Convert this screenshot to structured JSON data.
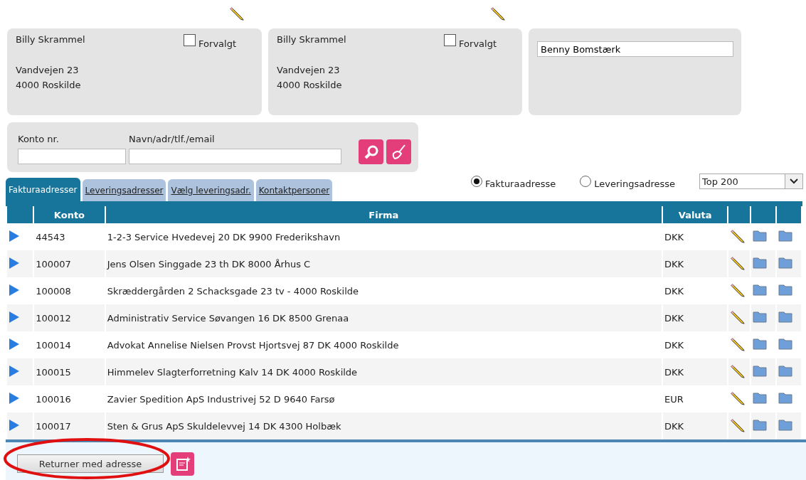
{
  "address_cards": [
    {
      "name": "Billy Skrammel",
      "default_label": "Forvalgt",
      "default_checked": false,
      "street": "Vandvejen 23",
      "city": "4000 Roskilde"
    },
    {
      "name": "Billy Skrammel",
      "default_label": "Forvalgt",
      "default_checked": false,
      "street": "Vandvejen 23",
      "city": "4000 Roskilde"
    }
  ],
  "contact_card": {
    "value": "Benny Bomstærk"
  },
  "search": {
    "fields": [
      {
        "label": "Konto nr."
      },
      {
        "label": "Navn/adr/tlf./email"
      }
    ]
  },
  "tabs": [
    {
      "label": "Fakturaadresser",
      "selected": true
    },
    {
      "label": "Leveringsadresser",
      "selected": false
    },
    {
      "label": "Vælg leveringsadr.",
      "selected": false
    },
    {
      "label": "Kontaktpersoner",
      "selected": false
    }
  ],
  "address_type": [
    {
      "label": "Fakturaadresse",
      "selected": true
    },
    {
      "label": "Leveringsadresse",
      "selected": false
    }
  ],
  "limit_select": {
    "value": "Top 200"
  },
  "table": {
    "columns": [
      "Konto",
      "Firma",
      "Valuta"
    ],
    "rows": [
      {
        "konto": "44543",
        "firma": "1-2-3 Service Hvedevej 20 DK 9900 Frederikshavn",
        "valuta": "DKK"
      },
      {
        "konto": "100007",
        "firma": "Jens Olsen Singgade 23 th DK 8000 Århus C",
        "valuta": "DKK"
      },
      {
        "konto": "100008",
        "firma": "Skræddergården 2 Schacksgade 23 tv - 4000 Roskilde",
        "valuta": "DKK"
      },
      {
        "konto": "100012",
        "firma": "Administrativ Service Søvangen 16 DK 8500 Grenaa",
        "valuta": "DKK"
      },
      {
        "konto": "100014",
        "firma": "Advokat Annelise Nielsen Provst Hjortsvej 87 DK 4000 Roskilde",
        "valuta": "DKK"
      },
      {
        "konto": "100015",
        "firma": "Himmelev Slagterforretning Kalv 14 DK 4000 Roskilde",
        "valuta": "DKK"
      },
      {
        "konto": "100016",
        "firma": "Zavier Spedition ApS Industrivej 52 D 9640 Farsø",
        "valuta": "EUR"
      },
      {
        "konto": "100017",
        "firma": "Sten & Grus ApS Skuldelevvej 14 DK 4300 Holbæk",
        "valuta": "DKK"
      }
    ]
  },
  "footer": {
    "return_button": "Returner med adresse",
    "highlighted": true
  }
}
